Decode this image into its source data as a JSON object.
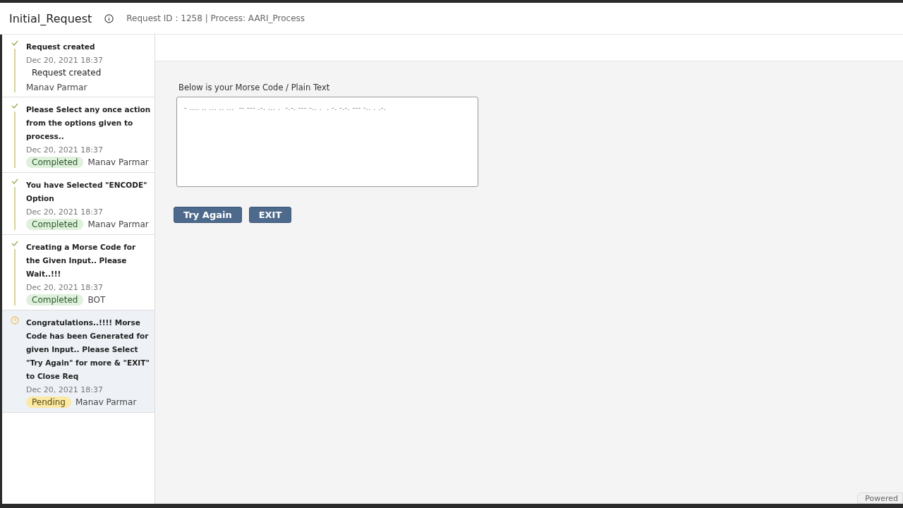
{
  "header": {
    "title": "Initial_Request",
    "info": "Request ID : 1258 | Process: AARI_Process"
  },
  "timeline": [
    {
      "kind": "done",
      "selected": false,
      "title": "Request created",
      "date": "Dec 20, 2021 18:37",
      "tag": {
        "kind": "plain",
        "label": "Request created"
      },
      "user": "Manav Parmar"
    },
    {
      "kind": "done",
      "selected": false,
      "title": "Please Select any once action from the options given to process..",
      "date": "Dec 20, 2021 18:37",
      "tag": {
        "kind": "completed",
        "label": "Completed"
      },
      "user": "Manav Parmar"
    },
    {
      "kind": "done",
      "selected": false,
      "title": "You have Selected \"ENCODE\" Option",
      "date": "Dec 20, 2021 18:37",
      "tag": {
        "kind": "completed",
        "label": "Completed"
      },
      "user": "Manav Parmar"
    },
    {
      "kind": "done",
      "selected": false,
      "title": "Creating a Morse Code for the Given Input.. Please Wait..!!!",
      "date": "Dec 20, 2021 18:37",
      "tag": {
        "kind": "completed",
        "label": "Completed"
      },
      "user": "BOT"
    },
    {
      "kind": "pending",
      "selected": true,
      "title": "Congratulations..!!!! Morse Code has been Generated for given Input.. Please Select \"Try Again\" for more & \"EXIT\" to Close Req",
      "date": "Dec 20, 2021 18:37",
      "tag": {
        "kind": "pending",
        "label": "Pending"
      },
      "user": "Manav Parmar"
    }
  ],
  "form": {
    "label": "Below is your Morse Code / Plain Text",
    "value": "- .... .. ... .. ...  -- --- .-. ... .  -.-. --- -.. .  . -. -.-. --- -.. . .-.",
    "buttons": [
      "Try Again",
      "EXIT"
    ]
  },
  "footer": {
    "badge": "Powered"
  }
}
